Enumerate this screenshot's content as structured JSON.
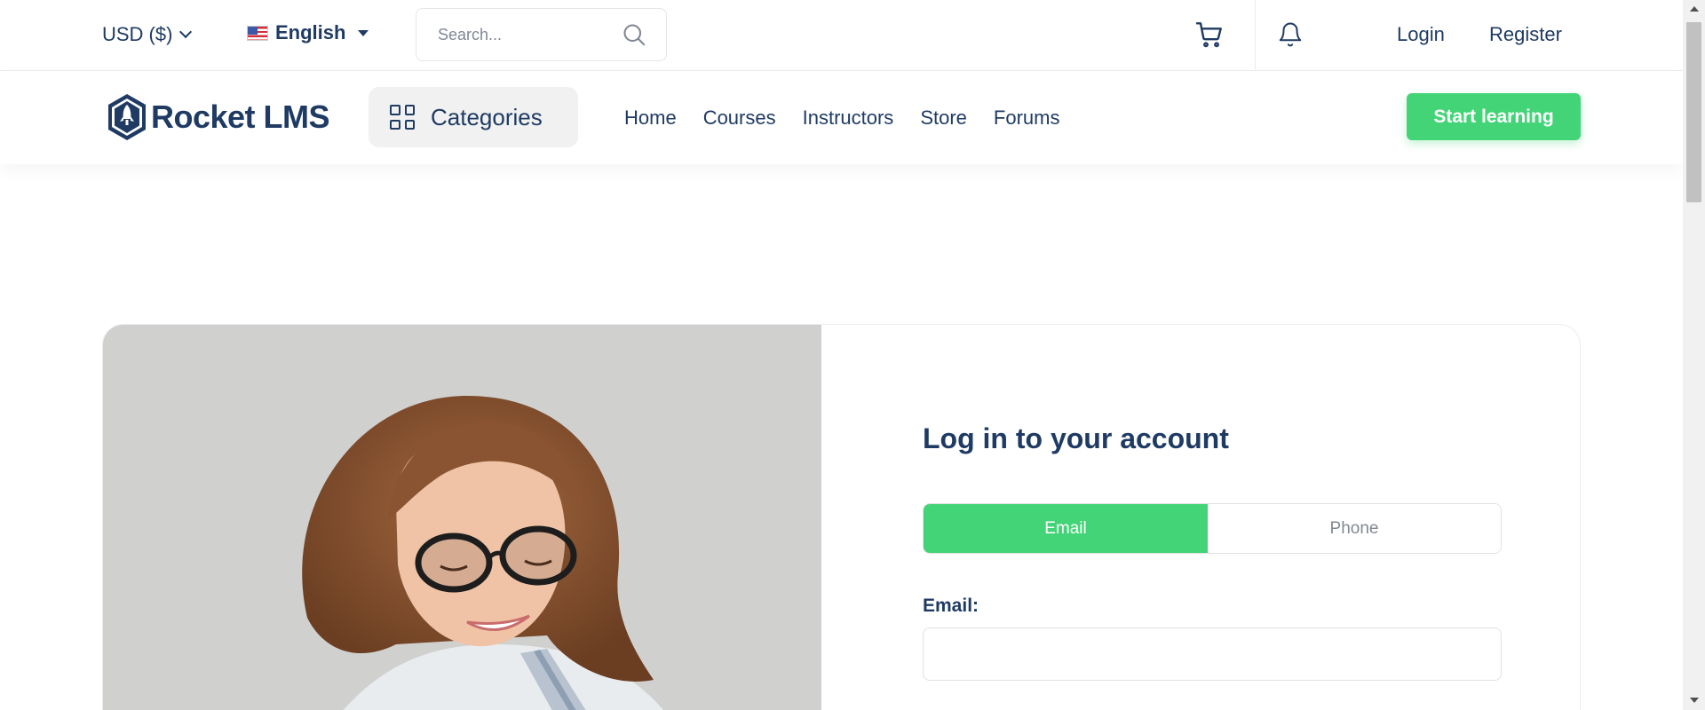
{
  "topbar": {
    "currency": "USD ($)",
    "language": "English",
    "search_placeholder": "Search...",
    "login": "Login",
    "register": "Register"
  },
  "navbar": {
    "logo_text": "Rocket LMS",
    "categories": "Categories",
    "menu": [
      "Home",
      "Courses",
      "Instructors",
      "Store",
      "Forums"
    ],
    "cta": "Start learning"
  },
  "login_form": {
    "title": "Log in to your account",
    "tabs": [
      "Email",
      "Phone"
    ],
    "active_tab": "Email",
    "email_label": "Email:",
    "email_value": ""
  },
  "colors": {
    "accent": "#43d477",
    "text_primary": "#1f3b64",
    "text_muted": "#818894"
  },
  "icons": {
    "search": "search-icon",
    "cart": "cart-icon",
    "bell": "bell-icon",
    "categories": "grid-icon"
  }
}
